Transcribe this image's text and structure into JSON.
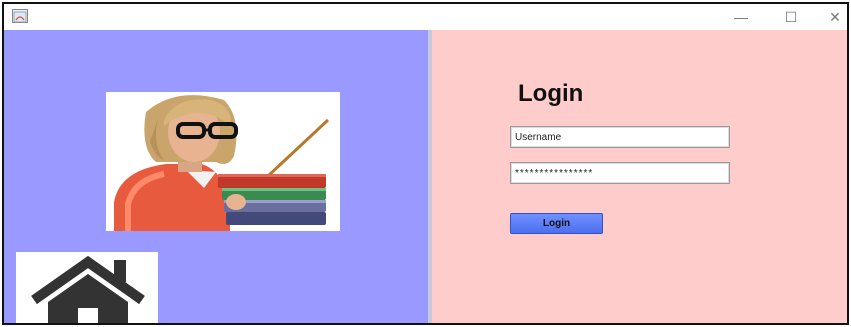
{
  "window": {
    "icon": "java-app-icon",
    "controls": {
      "minimize_icon": "—",
      "maximize_icon": "☐",
      "close_icon": "✕"
    }
  },
  "left_panel": {
    "background": "#9999ff",
    "images": [
      "teacher-icon",
      "home-icon"
    ]
  },
  "login": {
    "title": "Login",
    "username_value": "Username",
    "password_value": "****************",
    "button_label": "Login"
  },
  "colors": {
    "left_panel": "#9999ff",
    "right_panel": "#ffcccc",
    "button": "#5577ee"
  }
}
